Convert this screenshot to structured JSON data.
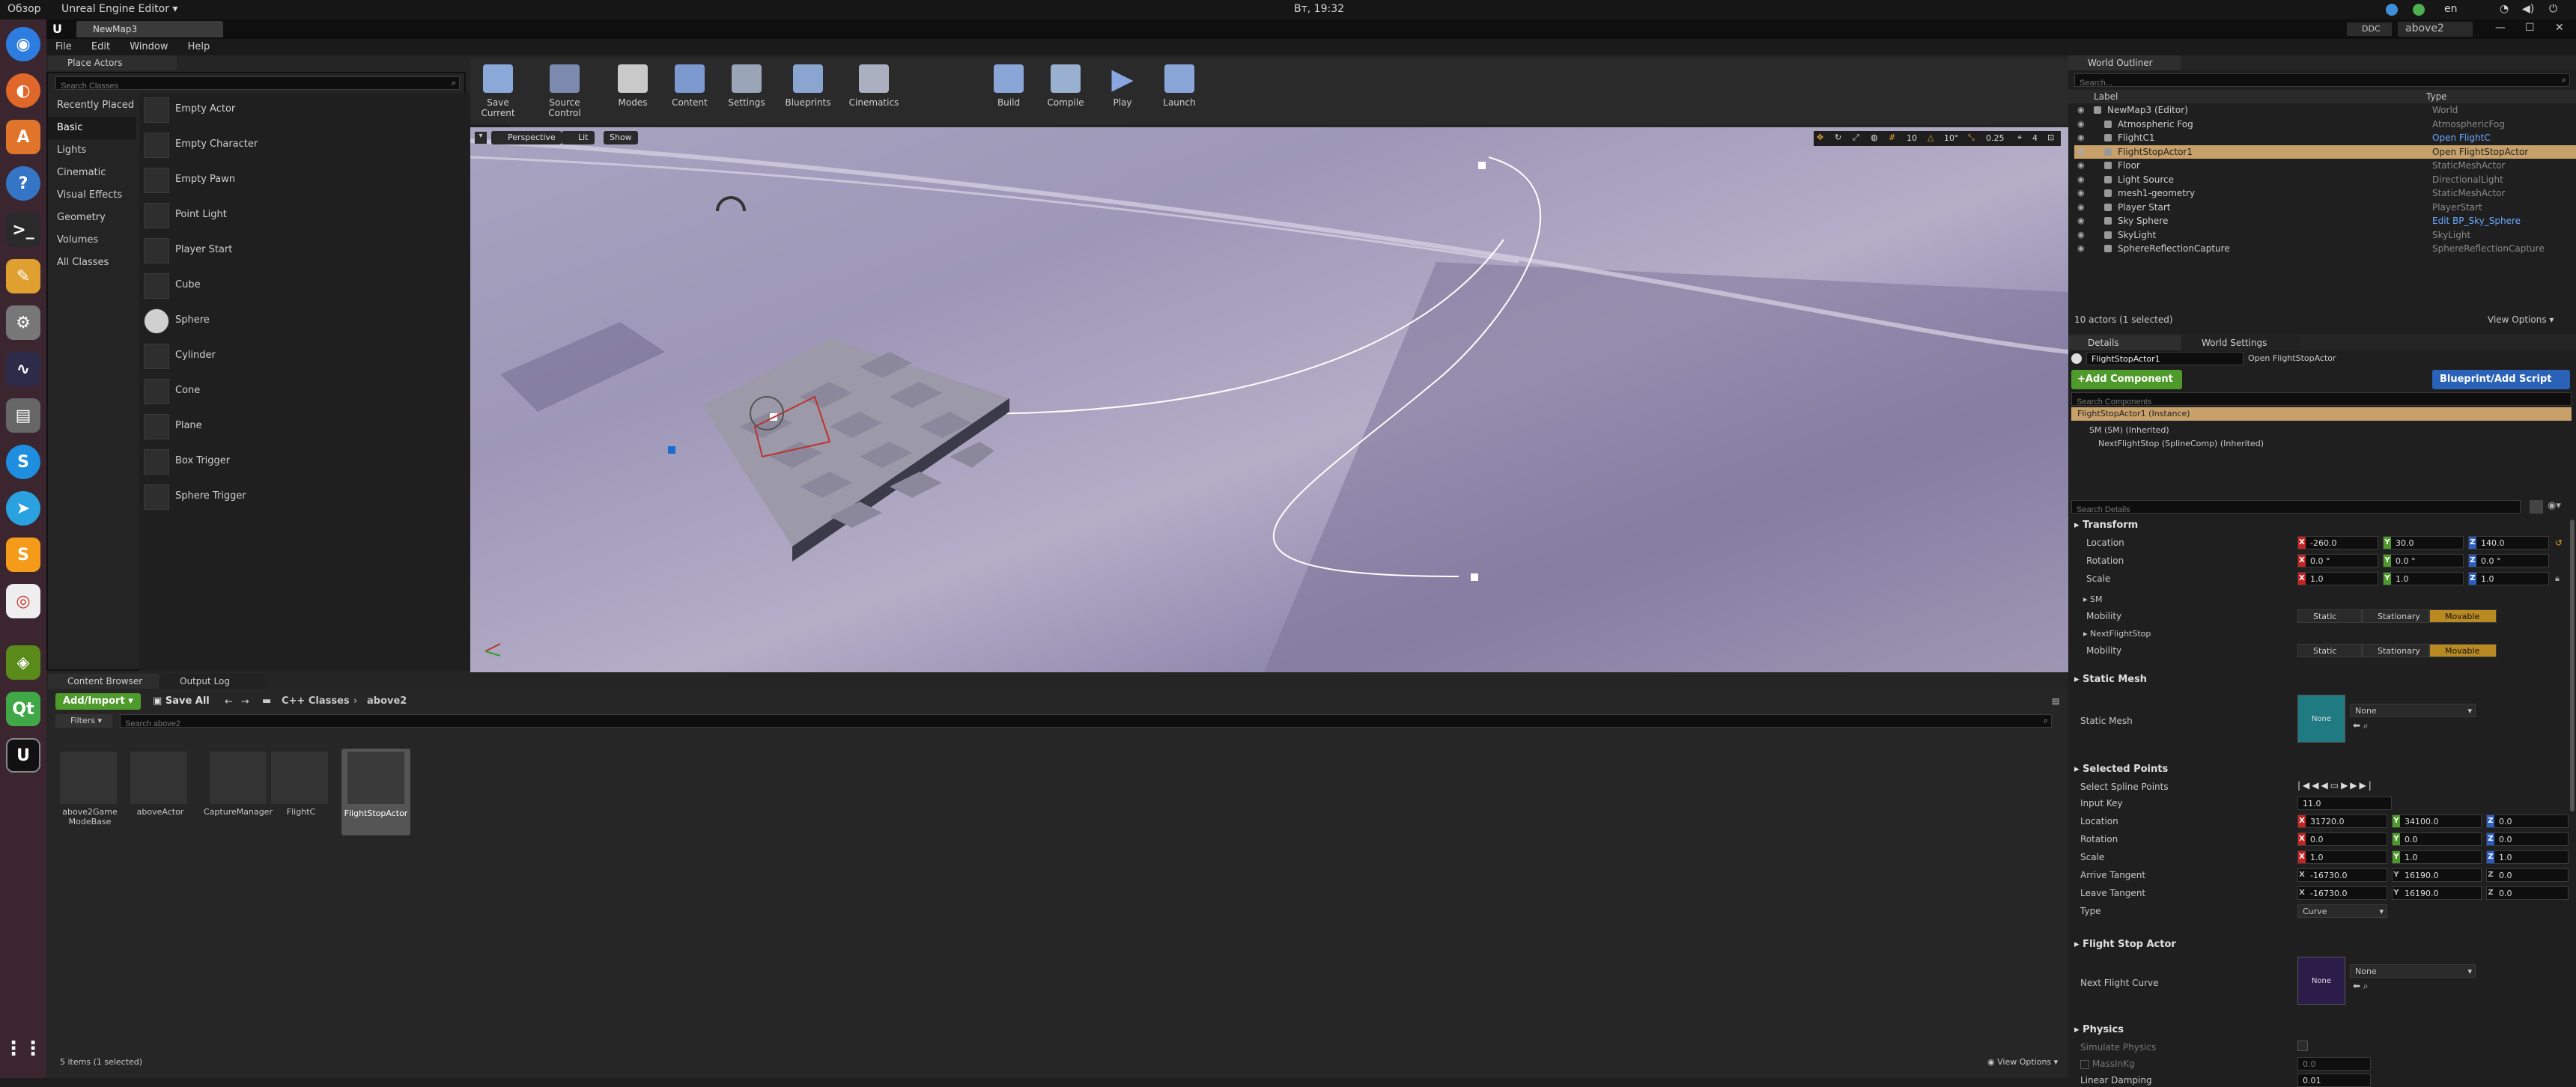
{
  "system": {
    "activities": "Обзор",
    "app_menu": "Unreal Engine Editor",
    "clock": "Вт, 19:32",
    "lang": "en"
  },
  "window": {
    "tab_title": "NewMap3",
    "ddc": "DDC",
    "project": "above2"
  },
  "menu": [
    "File",
    "Edit",
    "Window",
    "Help"
  ],
  "place_actors": {
    "tab": "Place Actors",
    "search_placeholder": "Search Classes",
    "categories": [
      "Recently Placed",
      "Basic",
      "Lights",
      "Cinematic",
      "Visual Effects",
      "Geometry",
      "Volumes",
      "All Classes"
    ],
    "selected_category": "Basic",
    "items": [
      "Empty Actor",
      "Empty Character",
      "Empty Pawn",
      "Point Light",
      "Player Start",
      "Cube",
      "Sphere",
      "Cylinder",
      "Cone",
      "Plane",
      "Box Trigger",
      "Sphere Trigger"
    ]
  },
  "toolbar": [
    "Save Current",
    "Source Control",
    "Modes",
    "Content",
    "Settings",
    "Blueprints",
    "Cinematics",
    "Build",
    "Compile",
    "Play",
    "Launch"
  ],
  "viewport": {
    "perspective": "Perspective",
    "lit": "Lit",
    "show": "Show",
    "snap1": "10",
    "snap2": "10°",
    "snap3": "0.25",
    "cam_speed": "4"
  },
  "outliner": {
    "tab": "World Outliner",
    "search_placeholder": "Search...",
    "col_label": "Label",
    "col_type": "Type",
    "rows": [
      {
        "label": "NewMap3 (Editor)",
        "type": "World"
      },
      {
        "label": "Atmospheric Fog",
        "type": "AtmosphericFog"
      },
      {
        "label": "FlightC1",
        "type": "Open FlightC"
      },
      {
        "label": "FlightStopActor1",
        "type": "Open FlightStopActor"
      },
      {
        "label": "Floor",
        "type": "StaticMeshActor"
      },
      {
        "label": "Light Source",
        "type": "DirectionalLight"
      },
      {
        "label": "mesh1-geometry",
        "type": "StaticMeshActor"
      },
      {
        "label": "Player Start",
        "type": "PlayerStart"
      },
      {
        "label": "Sky Sphere",
        "type": "Edit BP_Sky_Sphere"
      },
      {
        "label": "SkyLight",
        "type": "SkyLight"
      },
      {
        "label": "SphereReflectionCapture",
        "type": "SphereReflectionCapture"
      }
    ],
    "selected_row": 3,
    "footer": "10 actors (1 selected)",
    "view_options": "View Options"
  },
  "details": {
    "tab_details": "Details",
    "tab_world": "World Settings",
    "name": "FlightStopActor1",
    "open_link": "Open FlightStopActor",
    "add_component": "+Add Component",
    "blueprint_script": "Blueprint/Add Script",
    "search_components": "Search Components",
    "instance": "FlightStopActor1 (Instance)",
    "comp1": "SM (SM) (Inherited)",
    "comp2": "NextFlightStop (SplineComp) (Inherited)",
    "search_details": "Search Details",
    "transform": "Transform",
    "location_lbl": "Location",
    "rotation_lbl": "Rotation",
    "scale_lbl": "Scale",
    "location": [
      "-260.0",
      "30.0",
      "140.0"
    ],
    "rotation": [
      "0.0 °",
      "0.0 °",
      "0.0 °"
    ],
    "scale": [
      "1.0",
      "1.0",
      "1.0"
    ],
    "sm": "SM",
    "mobility": "Mobility",
    "next_flight_stop": "NextFlightStop",
    "mob_opts": [
      "Static",
      "Stationary",
      "Movable"
    ],
    "static_mesh_h": "Static Mesh",
    "static_mesh_lbl": "Static Mesh",
    "none": "None",
    "selected_points_h": "Selected Points",
    "select_spline_points": "Select Spline Points",
    "input_key_lbl": "Input Key",
    "input_key": "11.0",
    "sp_location": [
      "31720.0",
      "34100.0",
      "0.0"
    ],
    "sp_rotation": [
      "0.0",
      "0.0",
      "0.0"
    ],
    "sp_scale": [
      "1.0",
      "1.0",
      "1.0"
    ],
    "arrive_lbl": "Arrive Tangent",
    "leave_lbl": "Leave Tangent",
    "arrive": [
      "-16730.0",
      "16190.0",
      "0.0"
    ],
    "leave": [
      "-16730.0",
      "16190.0",
      "0.0"
    ],
    "type_lbl": "Type",
    "type": "Curve",
    "fsa_h": "Flight Stop Actor",
    "next_curve_lbl": "Next Flight Curve",
    "physics_h": "Physics",
    "simulate": "Simulate Physics",
    "mass": "MassInKg",
    "mass_val": "0.0",
    "damping": "Linear Damping",
    "damping_val": "0.01"
  },
  "content": {
    "tab_browser": "Content Browser",
    "tab_log": "Output Log",
    "add_import": "Add/Import",
    "save_all": "Save All",
    "path": [
      "C++ Classes",
      "above2"
    ],
    "filters": "Filters",
    "search_placeholder": "Search above2",
    "assets": [
      "above2Game ModeBase",
      "aboveActor",
      "CaptureManager",
      "FlightC",
      "FlightStopActor"
    ],
    "footer": "5 items (1 selected)",
    "view_options": "View Options"
  },
  "colors": {
    "selected": "#c7a06a",
    "accent": "#5bbd3a",
    "blue_button": "#2a62b8",
    "movable": "#b98a22"
  }
}
